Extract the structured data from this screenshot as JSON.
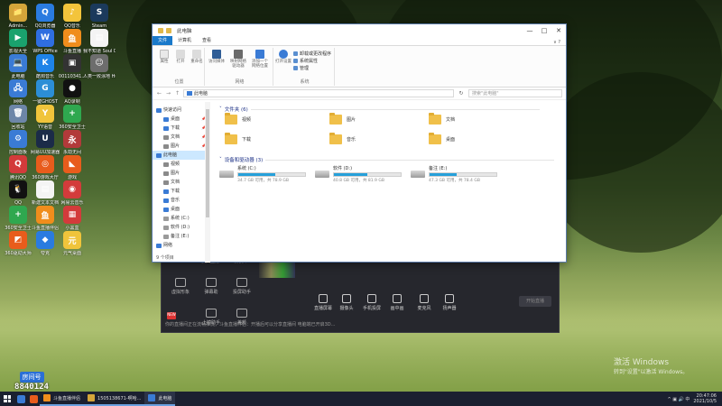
{
  "desktop_icons": [
    {
      "label": "Admin...",
      "color": "#d4a53a",
      "glyph": "📁"
    },
    {
      "label": "QQ浏览器",
      "color": "#2a7be0",
      "glyph": "Q"
    },
    {
      "label": "QQ音乐",
      "color": "#f3c43b",
      "glyph": "♪"
    },
    {
      "label": "Steam",
      "color": "#1b3a5c",
      "glyph": "S"
    },
    {
      "label": "影视大全",
      "color": "#1aa26d",
      "glyph": "▶"
    },
    {
      "label": "WPS Office",
      "color": "#2f6ee0",
      "glyph": "W"
    },
    {
      "label": "斗鱼直播",
      "color": "#f08d1c",
      "glyph": "鱼"
    },
    {
      "label": "我不知道 Soul D...",
      "color": "#f4f4f4",
      "glyph": "▤"
    },
    {
      "label": "此电脑",
      "color": "#3a7bd5",
      "glyph": "💻"
    },
    {
      "label": "酷狗音乐",
      "color": "#1e83e8",
      "glyph": "K"
    },
    {
      "label": "00110341...",
      "color": "#333333",
      "glyph": "▣"
    },
    {
      "label": "人类一败涂地 Human Fa...",
      "color": "#6d6d6d",
      "glyph": "☺"
    },
    {
      "label": "网络",
      "color": "#3a7bd5",
      "glyph": "🖧"
    },
    {
      "label": "一键GHOST",
      "color": "#2c8ed6",
      "glyph": "G"
    },
    {
      "label": "AQ录制",
      "color": "#111111",
      "glyph": "●"
    },
    {
      "label": "回收站",
      "color": "#6d86a8",
      "glyph": "🗑"
    },
    {
      "label": "YY语音",
      "color": "#f0c43b",
      "glyph": "Y"
    },
    {
      "label": "360安全卫士",
      "color": "#2fa84f",
      "glyph": "+"
    },
    {
      "label": "控制面板",
      "color": "#3a7bd5",
      "glyph": "⚙"
    },
    {
      "label": "网易UU加速器",
      "color": "#1b2b48",
      "glyph": "U"
    },
    {
      "label": "永劫无间",
      "color": "#b23a3a",
      "glyph": "永"
    },
    {
      "label": "腾讯QQ",
      "color": "#d33b3b",
      "glyph": "Q"
    },
    {
      "label": "360游戏大厅",
      "color": "#e85c1c",
      "glyph": "◎"
    },
    {
      "label": "游戏",
      "color": "#e85c1c",
      "glyph": "◣"
    },
    {
      "label": "QQ",
      "color": "#111111",
      "glyph": "🐧"
    },
    {
      "label": "新建文本文档",
      "color": "#f4f4f4",
      "glyph": "▤"
    },
    {
      "label": "网易云音乐",
      "color": "#d33b3b",
      "glyph": "◉"
    },
    {
      "label": "360安全卫士",
      "color": "#2fa84f",
      "glyph": "+"
    },
    {
      "label": "斗鱼直播伴侣",
      "color": "#f08d1c",
      "glyph": "鱼"
    },
    {
      "label": "小黑盒",
      "color": "#d33b3b",
      "glyph": "▦"
    },
    {
      "label": "360驱动大师",
      "color": "#e85c1c",
      "glyph": "◩"
    },
    {
      "label": "夸克",
      "color": "#2a7be0",
      "glyph": "◆"
    },
    {
      "label": "元气桌面",
      "color": "#f0c43b",
      "glyph": "元"
    }
  ],
  "brand": {
    "line1": "房间号",
    "line2": "8840124"
  },
  "activation": {
    "line1": "激活 Windows",
    "line2": "转到\"设置\"以激活 Windows。"
  },
  "stream_panel": {
    "top_tabs": [
      "",
      "加入直播",
      "模板库"
    ],
    "left_buttons": [
      "虚拟形象",
      "弹幕助",
      "投屏助手"
    ],
    "left_buttons_row2": [
      "",
      "上镜助手",
      "美颜"
    ],
    "tools": [
      "直播屏幕",
      "摄像头",
      "手机投屏",
      "画中画",
      "麦克风",
      "扬声器"
    ],
    "start_label": "开始直播",
    "status": "你的直播间正在流畅推流，斗鱼直播伴侣：开播后可以分享直播间 电脑端已开启3D..."
  },
  "explorer": {
    "title": "此电脑",
    "window_controls": {
      "minimize": "—",
      "maximize": "□",
      "close": "✕"
    },
    "ribbon_tabs": [
      "文件",
      "计算机",
      "查看"
    ],
    "ribbon_expand": "∨ ?",
    "ribbon_groups": [
      {
        "name": "位置",
        "buttons": [
          "属性",
          "打开",
          "重命名"
        ]
      },
      {
        "name": "网络",
        "buttons": [
          "访问媒体",
          "映射网络驱动器",
          "添加一个网络位置"
        ]
      },
      {
        "name": "系统",
        "buttons": [
          "打开设置"
        ]
      }
    ],
    "ribbon_small": [
      "卸载或更改程序",
      "系统属性",
      "管理"
    ],
    "nav_back": "←",
    "nav_forward": "→",
    "nav_up": "↑",
    "address_path": "此电脑",
    "search_placeholder": "搜索\"此电脑\"",
    "refresh": "↻",
    "nav_pane": [
      {
        "label": "快速访问",
        "color": "#3a7bd5",
        "pin": ""
      },
      {
        "label": "桌面",
        "color": "#3a7bd5",
        "pin": "📌"
      },
      {
        "label": "下载",
        "color": "#3a7bd5",
        "pin": "📌"
      },
      {
        "label": "文档",
        "color": "#8a8a8a",
        "pin": "📌"
      },
      {
        "label": "图片",
        "color": "#8a8a8a",
        "pin": "📌"
      },
      {
        "label": "此电脑",
        "color": "#3a7bd5",
        "pin": ""
      },
      {
        "label": "视频",
        "color": "#8a8a8a",
        "pin": ""
      },
      {
        "label": "图片",
        "color": "#8a8a8a",
        "pin": ""
      },
      {
        "label": "文档",
        "color": "#8a8a8a",
        "pin": ""
      },
      {
        "label": "下载",
        "color": "#3a7bd5",
        "pin": ""
      },
      {
        "label": "音乐",
        "color": "#3a7bd5",
        "pin": ""
      },
      {
        "label": "桌面",
        "color": "#3a7bd5",
        "pin": ""
      },
      {
        "label": "系统 (C:)",
        "color": "#9a9a9a",
        "pin": ""
      },
      {
        "label": "软件 (D:)",
        "color": "#9a9a9a",
        "pin": ""
      },
      {
        "label": "备注 (E:)",
        "color": "#9a9a9a",
        "pin": ""
      },
      {
        "label": "网络",
        "color": "#3a7bd5",
        "pin": ""
      }
    ],
    "folders_header": "文件夹 (6)",
    "folders": [
      {
        "label": "视频"
      },
      {
        "label": "图片"
      },
      {
        "label": "文档"
      },
      {
        "label": "下载"
      },
      {
        "label": "音乐"
      },
      {
        "label": "桌面"
      }
    ],
    "drives_header": "设备和驱动器 (3)",
    "drives": [
      {
        "name": "系统 (C:)",
        "free": "34.7 GB 可用，共 78.9 GB",
        "used_fraction": 0.56
      },
      {
        "name": "软件 (D:)",
        "free": "40.8 GB 可用，共 81.9 GB",
        "used_fraction": 0.5
      },
      {
        "name": "备注 (E:)",
        "free": "47.3 GB 可用，共 78.4 GB",
        "used_fraction": 0.4
      }
    ],
    "status": "9 个项目"
  },
  "taskbar": {
    "pinned_colors": [
      "#3a7bd5",
      "#e85c1c"
    ],
    "apps": [
      {
        "label": "斗鱼直播伴侣",
        "color": "#f08d1c"
      },
      {
        "label": "1505138671-啊哈...",
        "color": "#d4a53a"
      },
      {
        "label": "此电脑",
        "color": "#3a7bd5"
      }
    ],
    "tray_icons": "^ ▣ 🔊 中",
    "time": "20:47:06",
    "date": "2021/10/5"
  }
}
